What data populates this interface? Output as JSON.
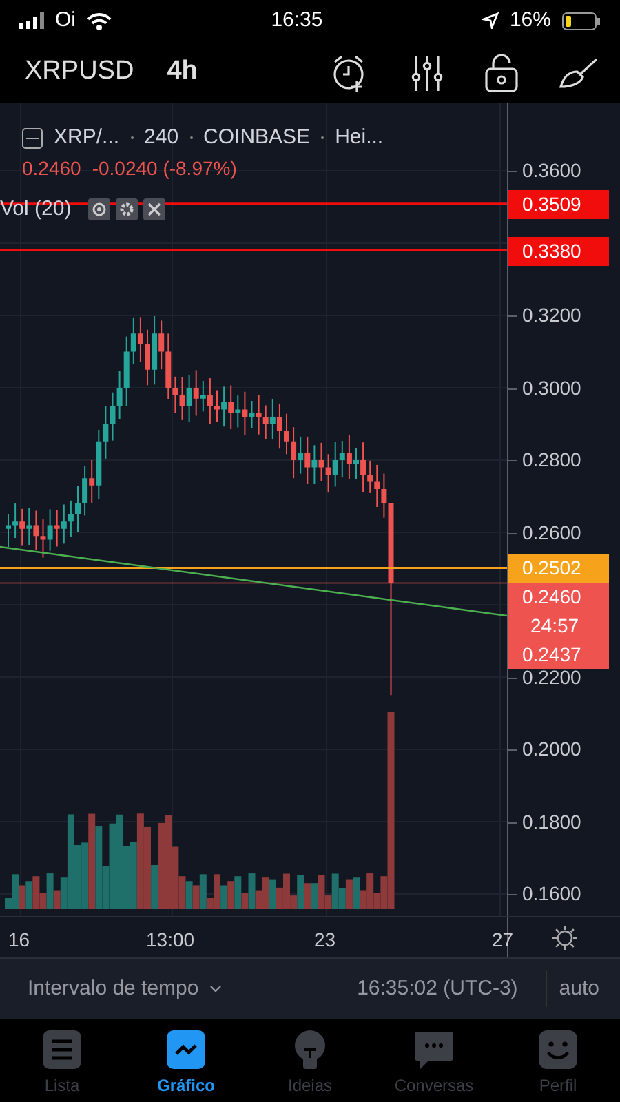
{
  "status_bar": {
    "carrier": "Oi",
    "time": "16:35",
    "battery": "16%"
  },
  "header": {
    "symbol": "XRPUSD",
    "interval": "4h"
  },
  "legend": {
    "symbol": "XRP/...",
    "interval": "240",
    "exchange": "COINBASE",
    "style": "Hei...",
    "price": "0.2460",
    "change": "-0.0240 (-8.97%)",
    "indicator": "Vol (20)"
  },
  "price_axis": [
    "0.3600",
    "0.3200",
    "0.3000",
    "0.2800",
    "0.2600",
    "0.2200",
    "0.2000",
    "0.1800",
    "0.1600"
  ],
  "price_tags": [
    {
      "kind": "price",
      "label": "0.3509",
      "color": "#f20d0d",
      "line": true
    },
    {
      "kind": "price",
      "label": "0.3380",
      "color": "#f20d0d",
      "line": true
    },
    {
      "kind": "price",
      "label": "0.2502",
      "color": "#f7a21b",
      "line": true
    },
    {
      "kind": "price",
      "label": "0.2460",
      "color": "#ef5350",
      "line": true
    },
    {
      "kind": "countdown",
      "label": "24:57",
      "color": "#ef5350"
    },
    {
      "kind": "price",
      "label": "0.2437",
      "color": "#ef5350"
    }
  ],
  "time_axis": [
    "16",
    "13:00",
    "23",
    "27"
  ],
  "footer": {
    "range": "Intervalo de tempo",
    "clock": "16:35:02 (UTC-3)",
    "scale": "auto"
  },
  "tabs": [
    {
      "label": "Lista",
      "kind": "list",
      "selected": false
    },
    {
      "label": "Gráfico",
      "kind": "chart",
      "selected": true
    },
    {
      "label": "Ideias",
      "kind": "idea",
      "selected": false
    },
    {
      "label": "Conversas",
      "kind": "chat",
      "selected": false
    },
    {
      "label": "Perfil",
      "kind": "profile",
      "selected": false
    }
  ]
}
